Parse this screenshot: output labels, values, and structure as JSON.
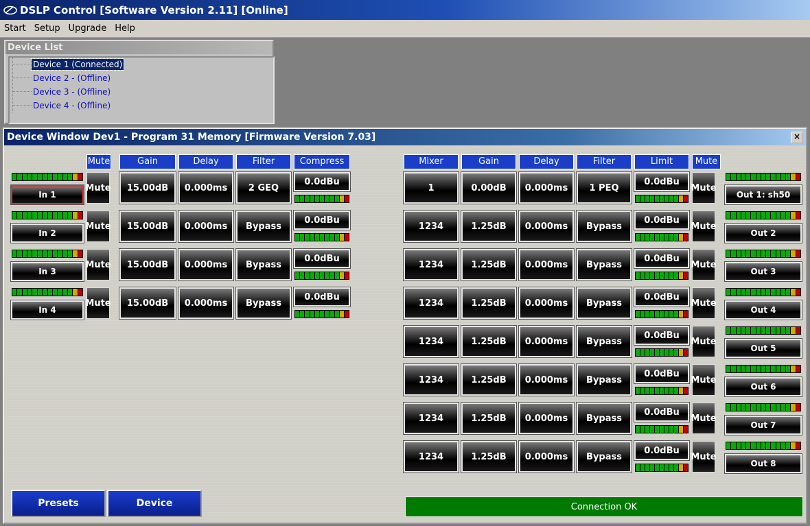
{
  "window": {
    "title": "DSLP Control [Software Version 2.11] [Online]",
    "logo_icon": "dslp-logo-icon"
  },
  "menu": [
    "Start",
    "Setup",
    "Upgrade",
    "Help"
  ],
  "device_list": {
    "header": "Device List",
    "items": [
      {
        "label": "Device 1 (Connected)",
        "selected": true
      },
      {
        "label": "Device 2 -  (Offline)",
        "selected": false
      },
      {
        "label": "Device 3 -  (Offline)",
        "selected": false
      },
      {
        "label": "Device 4 -  (Offline)",
        "selected": false
      }
    ]
  },
  "device_window": {
    "title": "Device Window Dev1 -   Program 31  Memory [Firmware Version 7.03]",
    "close_label": "×",
    "input_headers": [
      "Mute",
      "Gain",
      "Delay",
      "Filter",
      "Compress"
    ],
    "output_headers": [
      "Mixer",
      "Gain",
      "Delay",
      "Filter",
      "Limit",
      "Mute"
    ],
    "inputs": [
      {
        "name": "In 1",
        "mute": "Mute",
        "gain": "15.00dB",
        "delay": "0.000ms",
        "filter": "2 GEQ",
        "compress": "0.0dBu",
        "selected": true
      },
      {
        "name": "In 2",
        "mute": "Mute",
        "gain": "15.00dB",
        "delay": "0.000ms",
        "filter": "Bypass",
        "compress": "0.0dBu",
        "selected": false
      },
      {
        "name": "In 3",
        "mute": "Mute",
        "gain": "15.00dB",
        "delay": "0.000ms",
        "filter": "Bypass",
        "compress": "0.0dBu",
        "selected": false
      },
      {
        "name": "In 4",
        "mute": "Mute",
        "gain": "15.00dB",
        "delay": "0.000ms",
        "filter": "Bypass",
        "compress": "0.0dBu",
        "selected": false
      }
    ],
    "outputs": [
      {
        "name": "Out 1: sh50",
        "mixer": "1",
        "gain": "0.00dB",
        "delay": "0.000ms",
        "filter": "1 PEQ",
        "limit": "0.0dBu",
        "mute": "Mute"
      },
      {
        "name": "Out 2",
        "mixer": "1234",
        "gain": "1.25dB",
        "delay": "0.000ms",
        "filter": "Bypass",
        "limit": "0.0dBu",
        "mute": "Mute"
      },
      {
        "name": "Out 3",
        "mixer": "1234",
        "gain": "1.25dB",
        "delay": "0.000ms",
        "filter": "Bypass",
        "limit": "0.0dBu",
        "mute": "Mute"
      },
      {
        "name": "Out 4",
        "mixer": "1234",
        "gain": "1.25dB",
        "delay": "0.000ms",
        "filter": "Bypass",
        "limit": "0.0dBu",
        "mute": "Mute"
      },
      {
        "name": "Out 5",
        "mixer": "1234",
        "gain": "1.25dB",
        "delay": "0.000ms",
        "filter": "Bypass",
        "limit": "0.0dBu",
        "mute": "Mute"
      },
      {
        "name": "Out 6",
        "mixer": "1234",
        "gain": "1.25dB",
        "delay": "0.000ms",
        "filter": "Bypass",
        "limit": "0.0dBu",
        "mute": "Mute"
      },
      {
        "name": "Out 7",
        "mixer": "1234",
        "gain": "1.25dB",
        "delay": "0.000ms",
        "filter": "Bypass",
        "limit": "0.0dBu",
        "mute": "Mute"
      },
      {
        "name": "Out 8",
        "mixer": "1234",
        "gain": "1.25dB",
        "delay": "0.000ms",
        "filter": "Bypass",
        "limit": "0.0dBu",
        "mute": "Mute"
      }
    ],
    "buttons": {
      "presets": "Presets",
      "device": "Device"
    },
    "status": {
      "text": "Connection OK",
      "color": "#007a00"
    },
    "meter_colors": {
      "green": "#0ba80b",
      "yellow": "#c8b000",
      "red": "#c00000"
    }
  }
}
